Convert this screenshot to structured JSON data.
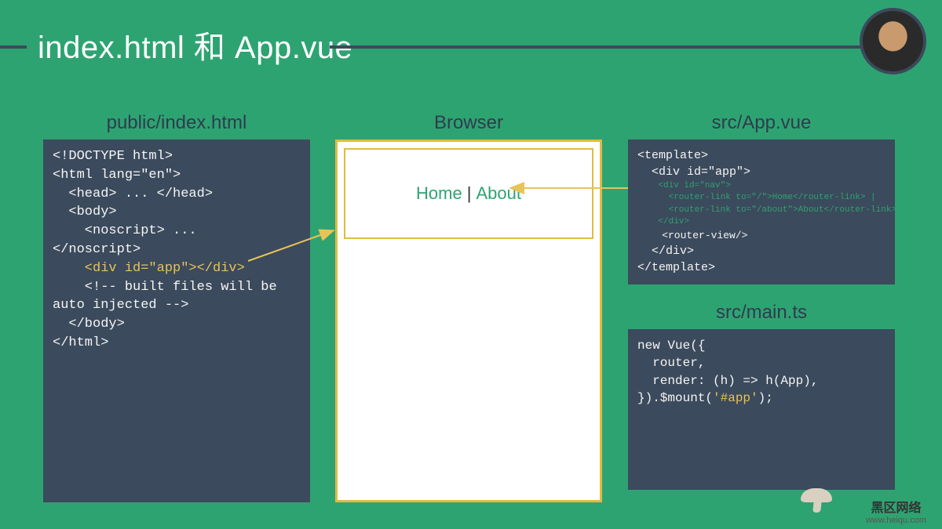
{
  "title": "index.html 和 App.vue",
  "panels": {
    "left": {
      "title": "public/index.html",
      "code": [
        {
          "t": "<!DOCTYPE html>",
          "cls": ""
        },
        {
          "t": "<html lang=\"en\">",
          "cls": ""
        },
        {
          "t": "  <head> ... </head>",
          "cls": ""
        },
        {
          "t": "  <body>",
          "cls": ""
        },
        {
          "t": "    <noscript> ...",
          "cls": ""
        },
        {
          "t": "</noscript>",
          "cls": ""
        },
        {
          "t": "    <div id=\"app\"></div>",
          "cls": "hl-yellow"
        },
        {
          "t": "    <!-- built files will be",
          "cls": ""
        },
        {
          "t": "auto injected -->",
          "cls": ""
        },
        {
          "t": "  </body>",
          "cls": ""
        },
        {
          "t": "</html>",
          "cls": ""
        }
      ]
    },
    "browser": {
      "title": "Browser",
      "home_label": "Home",
      "separator": "|",
      "about_label": "About"
    },
    "appvue": {
      "title": "src/App.vue",
      "lines": [
        {
          "t": "<template>",
          "cls": "",
          "sz": "n"
        },
        {
          "t": "  <div id=\"app\">",
          "cls": "",
          "sz": "n"
        },
        {
          "t": "    <div id=\"nav\">",
          "cls": "hl-green",
          "sz": "xs"
        },
        {
          "t": "      <router-link to=\"/\">Home</router-link> |",
          "cls": "hl-green",
          "sz": "xs"
        },
        {
          "t": "      <router-link to=\"/about\">About</router-link>",
          "cls": "hl-green",
          "sz": "xs"
        },
        {
          "t": "    </div>",
          "cls": "hl-green",
          "sz": "xs"
        },
        {
          "t": "    <router-view/>",
          "cls": "",
          "sz": "s"
        },
        {
          "t": "  </div>",
          "cls": "",
          "sz": "n"
        },
        {
          "t": "</template>",
          "cls": "",
          "sz": "n"
        }
      ]
    },
    "main": {
      "title": "src/main.ts",
      "lines": [
        {
          "t": "new Vue({",
          "cls": ""
        },
        {
          "t": "  router,",
          "cls": ""
        },
        {
          "t": "  render: (h) => h(App),",
          "cls": ""
        },
        {
          "segments": [
            {
              "t": "}).$mount(",
              "cls": ""
            },
            {
              "t": "'#app'",
              "cls": "hl-yellow"
            },
            {
              "t": ");",
              "cls": ""
            }
          ]
        }
      ]
    }
  },
  "watermark": {
    "line1": "黑区网络",
    "line2": "www.heiqu.com"
  }
}
